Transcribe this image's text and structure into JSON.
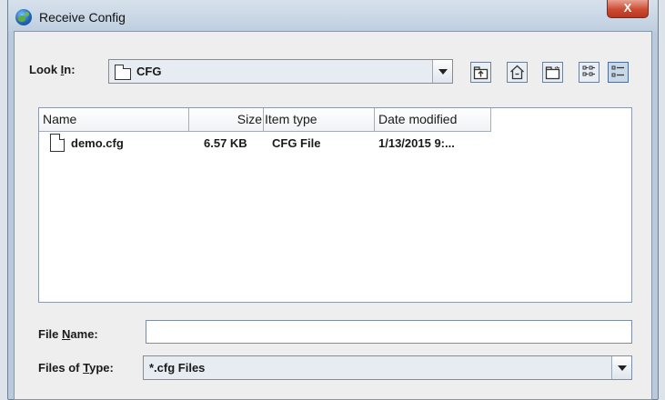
{
  "window": {
    "title": "Receive Config",
    "close_label": "X"
  },
  "look_in": {
    "label_prefix": "Look ",
    "label_mnemonic": "I",
    "label_suffix": "n:",
    "value": "CFG"
  },
  "toolbar": {
    "buttons": [
      "up-one-level-icon",
      "home-icon",
      "new-folder-icon",
      "list-view-icon",
      "details-view-icon"
    ],
    "active": "details-view-icon"
  },
  "file_list": {
    "columns": [
      "Name",
      "Size",
      "Item type",
      "Date modified"
    ],
    "rows": [
      {
        "name": "demo.cfg",
        "size": "6.57 KB",
        "type": "CFG File",
        "modified": "1/13/2015 9:..."
      }
    ]
  },
  "file_name": {
    "label_prefix": "File ",
    "label_mnemonic": "N",
    "label_suffix": "ame:",
    "value": ""
  },
  "files_of_type": {
    "label_prefix": "Files of ",
    "label_mnemonic": "T",
    "label_suffix": "ype:",
    "value": "*.cfg Files"
  },
  "colors": {
    "title_bar": "#c9d6e4",
    "close_button": "#cc4b32",
    "client_bg": "#eeeeee"
  }
}
